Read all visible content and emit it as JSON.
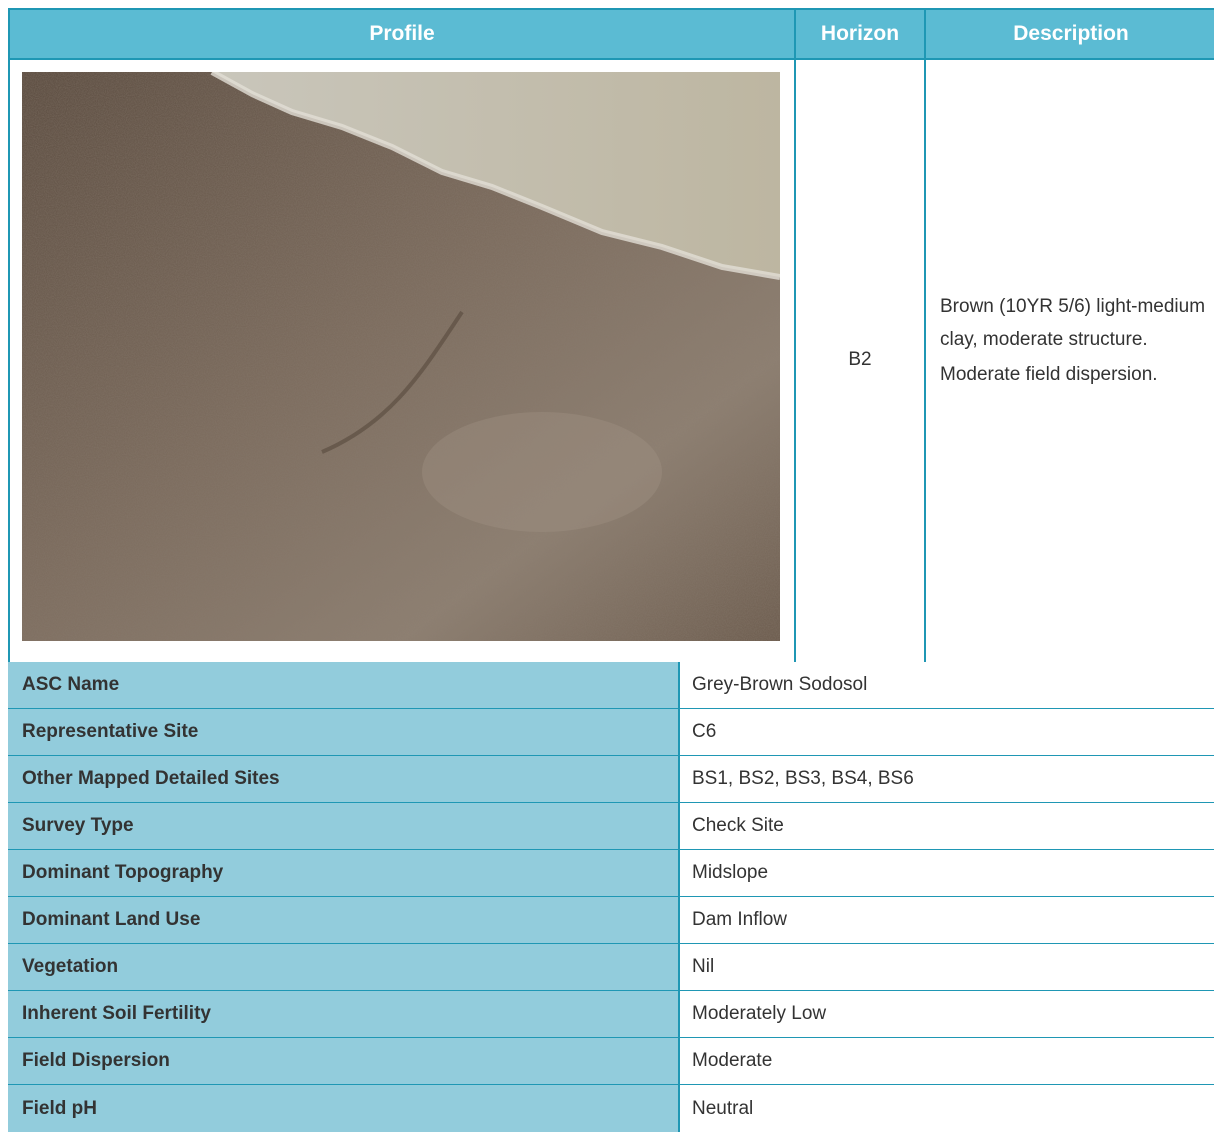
{
  "header": {
    "profile": "Profile",
    "horizon": "Horizon",
    "description": "Description"
  },
  "horizon": "B2",
  "description": {
    "line1": "Brown (10YR 5/6) light-medium clay, moderate structure.",
    "line2": "Moderate field dispersion."
  },
  "colors": {
    "header_bg": "#5bbbd3",
    "label_bg": "#92ccdc",
    "border": "#1f97b4"
  },
  "attributes": [
    {
      "label": "ASC Name",
      "value": "Grey-Brown Sodosol"
    },
    {
      "label": "Representative Site",
      "value": "C6"
    },
    {
      "label": "Other Mapped Detailed Sites",
      "value": "BS1, BS2, BS3, BS4, BS6"
    },
    {
      "label": "Survey Type",
      "value": "Check Site"
    },
    {
      "label": "Dominant Topography",
      "value": "Midslope"
    },
    {
      "label": "Dominant Land Use",
      "value": "Dam Inflow"
    },
    {
      "label": "Vegetation",
      "value": "Nil"
    },
    {
      "label": "Inherent Soil Fertility",
      "value": "Moderately Low"
    },
    {
      "label": "Field Dispersion",
      "value": "Moderate"
    },
    {
      "label": "Field pH",
      "value": "Neutral"
    }
  ]
}
